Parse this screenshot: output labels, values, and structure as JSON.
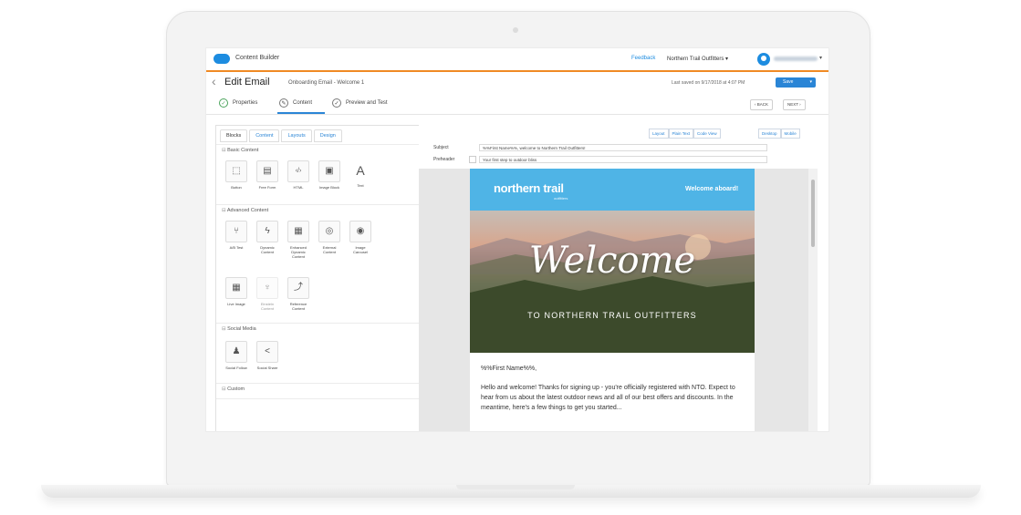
{
  "app": {
    "title": "Content Builder",
    "feedback": "Feedback",
    "org": "Northern Trail Outfitters ▾",
    "user_chevron": "▾"
  },
  "header": {
    "back": "‹",
    "title": "Edit Email",
    "email_name": "Onboarding Email - Welcome 1",
    "last_saved": "Last saved on 9/17/2018 at 4:07 PM",
    "save": "Save"
  },
  "steps": [
    {
      "label": "Properties",
      "icon": "✓"
    },
    {
      "label": "Content",
      "icon": "✎"
    },
    {
      "label": "Preview and Test",
      "icon": "✓"
    }
  ],
  "nav": {
    "back": "‹ BACK",
    "next": "NEXT ›"
  },
  "left_tabs": [
    "Blocks",
    "Content",
    "Layouts",
    "Design"
  ],
  "sections": {
    "basic": "Basic Content",
    "advanced": "Advanced Content",
    "social": "Social Media",
    "custom": "Custom"
  },
  "basic_blocks": [
    {
      "label": "Button",
      "icon": "⬚"
    },
    {
      "label": "Free Form",
      "icon": "▤"
    },
    {
      "label": "HTML",
      "icon": "‹/›"
    },
    {
      "label": "Image Block",
      "icon": "▣"
    },
    {
      "label": "Text",
      "icon": "A"
    }
  ],
  "advanced_blocks": [
    {
      "label": "A/B Test",
      "icon": "⑂"
    },
    {
      "label": "Dynamic Content",
      "icon": "ϟ"
    },
    {
      "label": "Enhanced Dynamic Content",
      "icon": "▦"
    },
    {
      "label": "External Content",
      "icon": "◎"
    },
    {
      "label": "Image Carousel",
      "icon": "◉"
    },
    {
      "label": "Live Image",
      "icon": "▦"
    },
    {
      "label": "Einstein Content",
      "icon": "♆"
    },
    {
      "label": "Reference Content",
      "icon": "⤴"
    }
  ],
  "social_blocks": [
    {
      "label": "Social Follow",
      "icon": "♟"
    },
    {
      "label": "Social Share",
      "icon": "<"
    }
  ],
  "view_buttons": {
    "layout": "Layout",
    "plain": "Plain Text",
    "code": "Code View",
    "desktop": "Desktop",
    "mobile": "Mobile"
  },
  "fields": {
    "subject_label": "Subject",
    "subject_value": "%%First Name%%, welcome to Northern Trail Outfitters!",
    "preheader_label": "Preheader",
    "preheader_value": "Your first step to outdoor bliss"
  },
  "email": {
    "brand": "northern trail",
    "brand_sub": "outfitters",
    "welcome_aboard": "Welcome aboard!",
    "hero_title": "Welcome",
    "hero_sub": "TO NORTHERN TRAIL OUTFITTERS",
    "greeting": "%%First Name%%,",
    "paragraph": "Hello and welcome! Thanks for signing up - you're officially registered with NTO. Expect to hear from us about the latest outdoor news and all of our best offers and discounts. In the meantime, here's a few things to get you started..."
  },
  "colors": {
    "accent": "#2a85d6",
    "topbar_border": "#f08a24",
    "email_header": "#4fb4e6"
  }
}
